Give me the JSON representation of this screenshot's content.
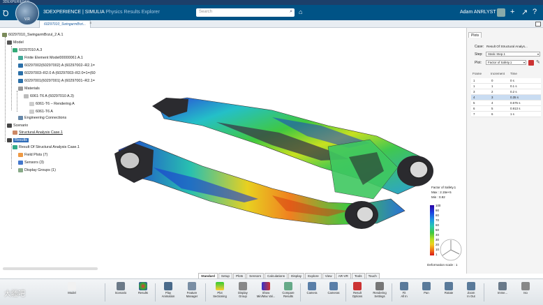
{
  "window": {
    "title": "3DEXPERIENCE"
  },
  "header": {
    "brand_bold": "3D",
    "brand_rest": "EXPERIENCE | SIMULIA",
    "app_name": "Physics Results Explorer",
    "compass_version": "V.R",
    "search_placeholder": "Search",
    "user_name": "Adam ANRLYST"
  },
  "doc_tab": {
    "label": "60297010_SwingarmBrzi..."
  },
  "tree": {
    "root": "60297010_SwingarmBrzul_2 A.1",
    "model": "Model",
    "model_child": "60297010 A.3",
    "fem": "Finite Element Model00000061 A.1",
    "mesh1": "60297002(60297002) A (60297002–R2.1=",
    "mesh2": "60297003–R2.0 A (60297003–R2.0=1=(60",
    "mesh3": "60297001(60297001) A (60297001–R2.1=",
    "materials": "Materials",
    "mat1": "6061-T6 A (60297010 A.3)",
    "mat1a": "6061-T6 – Rendering A",
    "mat1b": "6061-T6 A",
    "eng_conn": "Engineering Connections",
    "scenario": "Scenario",
    "sac": "Structural Analysis Case.1",
    "results": "Results",
    "result_item": "Result Of Structural Analysis Case.1",
    "field_plots": "Field Plots (7)",
    "sensors": "Sensors (3)",
    "display_groups": "Display Groups (1)"
  },
  "legend": {
    "title": "Factor of Safety.1",
    "max": "Max : 2.15e+5",
    "min": "Min : 0.92",
    "ticks": [
      "100",
      "90",
      "80",
      "70",
      "60",
      "50",
      "40",
      "30",
      "20",
      "10",
      "1"
    ],
    "deformation": "Deformation scale : 1"
  },
  "plots_panel": {
    "tab": "Plots",
    "case_label": "Case:",
    "case_value": "Result Of Structural Analys...",
    "step_label": "Step:",
    "step_value": "Static Step.1",
    "plot_label": "Plot:",
    "plot_value": "Factor of Safety.1",
    "columns": [
      "Frame",
      "Increment",
      "Time"
    ],
    "rows": [
      [
        "1",
        "0",
        "0 s"
      ],
      [
        "1",
        "1",
        "0.1 s"
      ],
      [
        "3",
        "2",
        "0.2 s"
      ],
      [
        "4",
        "3",
        "0.35 s"
      ],
      [
        "5",
        "4",
        "0.575 s"
      ],
      [
        "6",
        "5",
        "0.913 s"
      ],
      [
        "7",
        "6",
        "1 s"
      ]
    ]
  },
  "bottom_tabs": [
    "Standard",
    "Setup",
    "Plots",
    "Sensors",
    "Calculations",
    "Display",
    "Explore",
    "View",
    "AR-VR",
    "Tools",
    "Touch"
  ],
  "toolbar": {
    "model": "Model",
    "scenario": "Scenario",
    "results": "Results",
    "play_animation": "Play\nAnimation",
    "feature_manager": "Feature\nManager",
    "plot_sectioning": "Plot\nSectioning",
    "display_group": "Display\nGroup",
    "show_minmax": "Show\nMin/Max Val...",
    "compare_results": "Compare\nResults",
    "camera": "Camera",
    "cameras": "Cameras",
    "result_options": "Result\nOptions",
    "rendering_settings": "Rendering\nSettings",
    "fit_all_in": "Fit\nAll In",
    "pan": "Pan",
    "rotate": "Rotate",
    "zoom_in_out": "Zoom\nIn Out",
    "immersive": "Imme...",
    "iso": "Iso"
  },
  "watermark": "大疆吧"
}
